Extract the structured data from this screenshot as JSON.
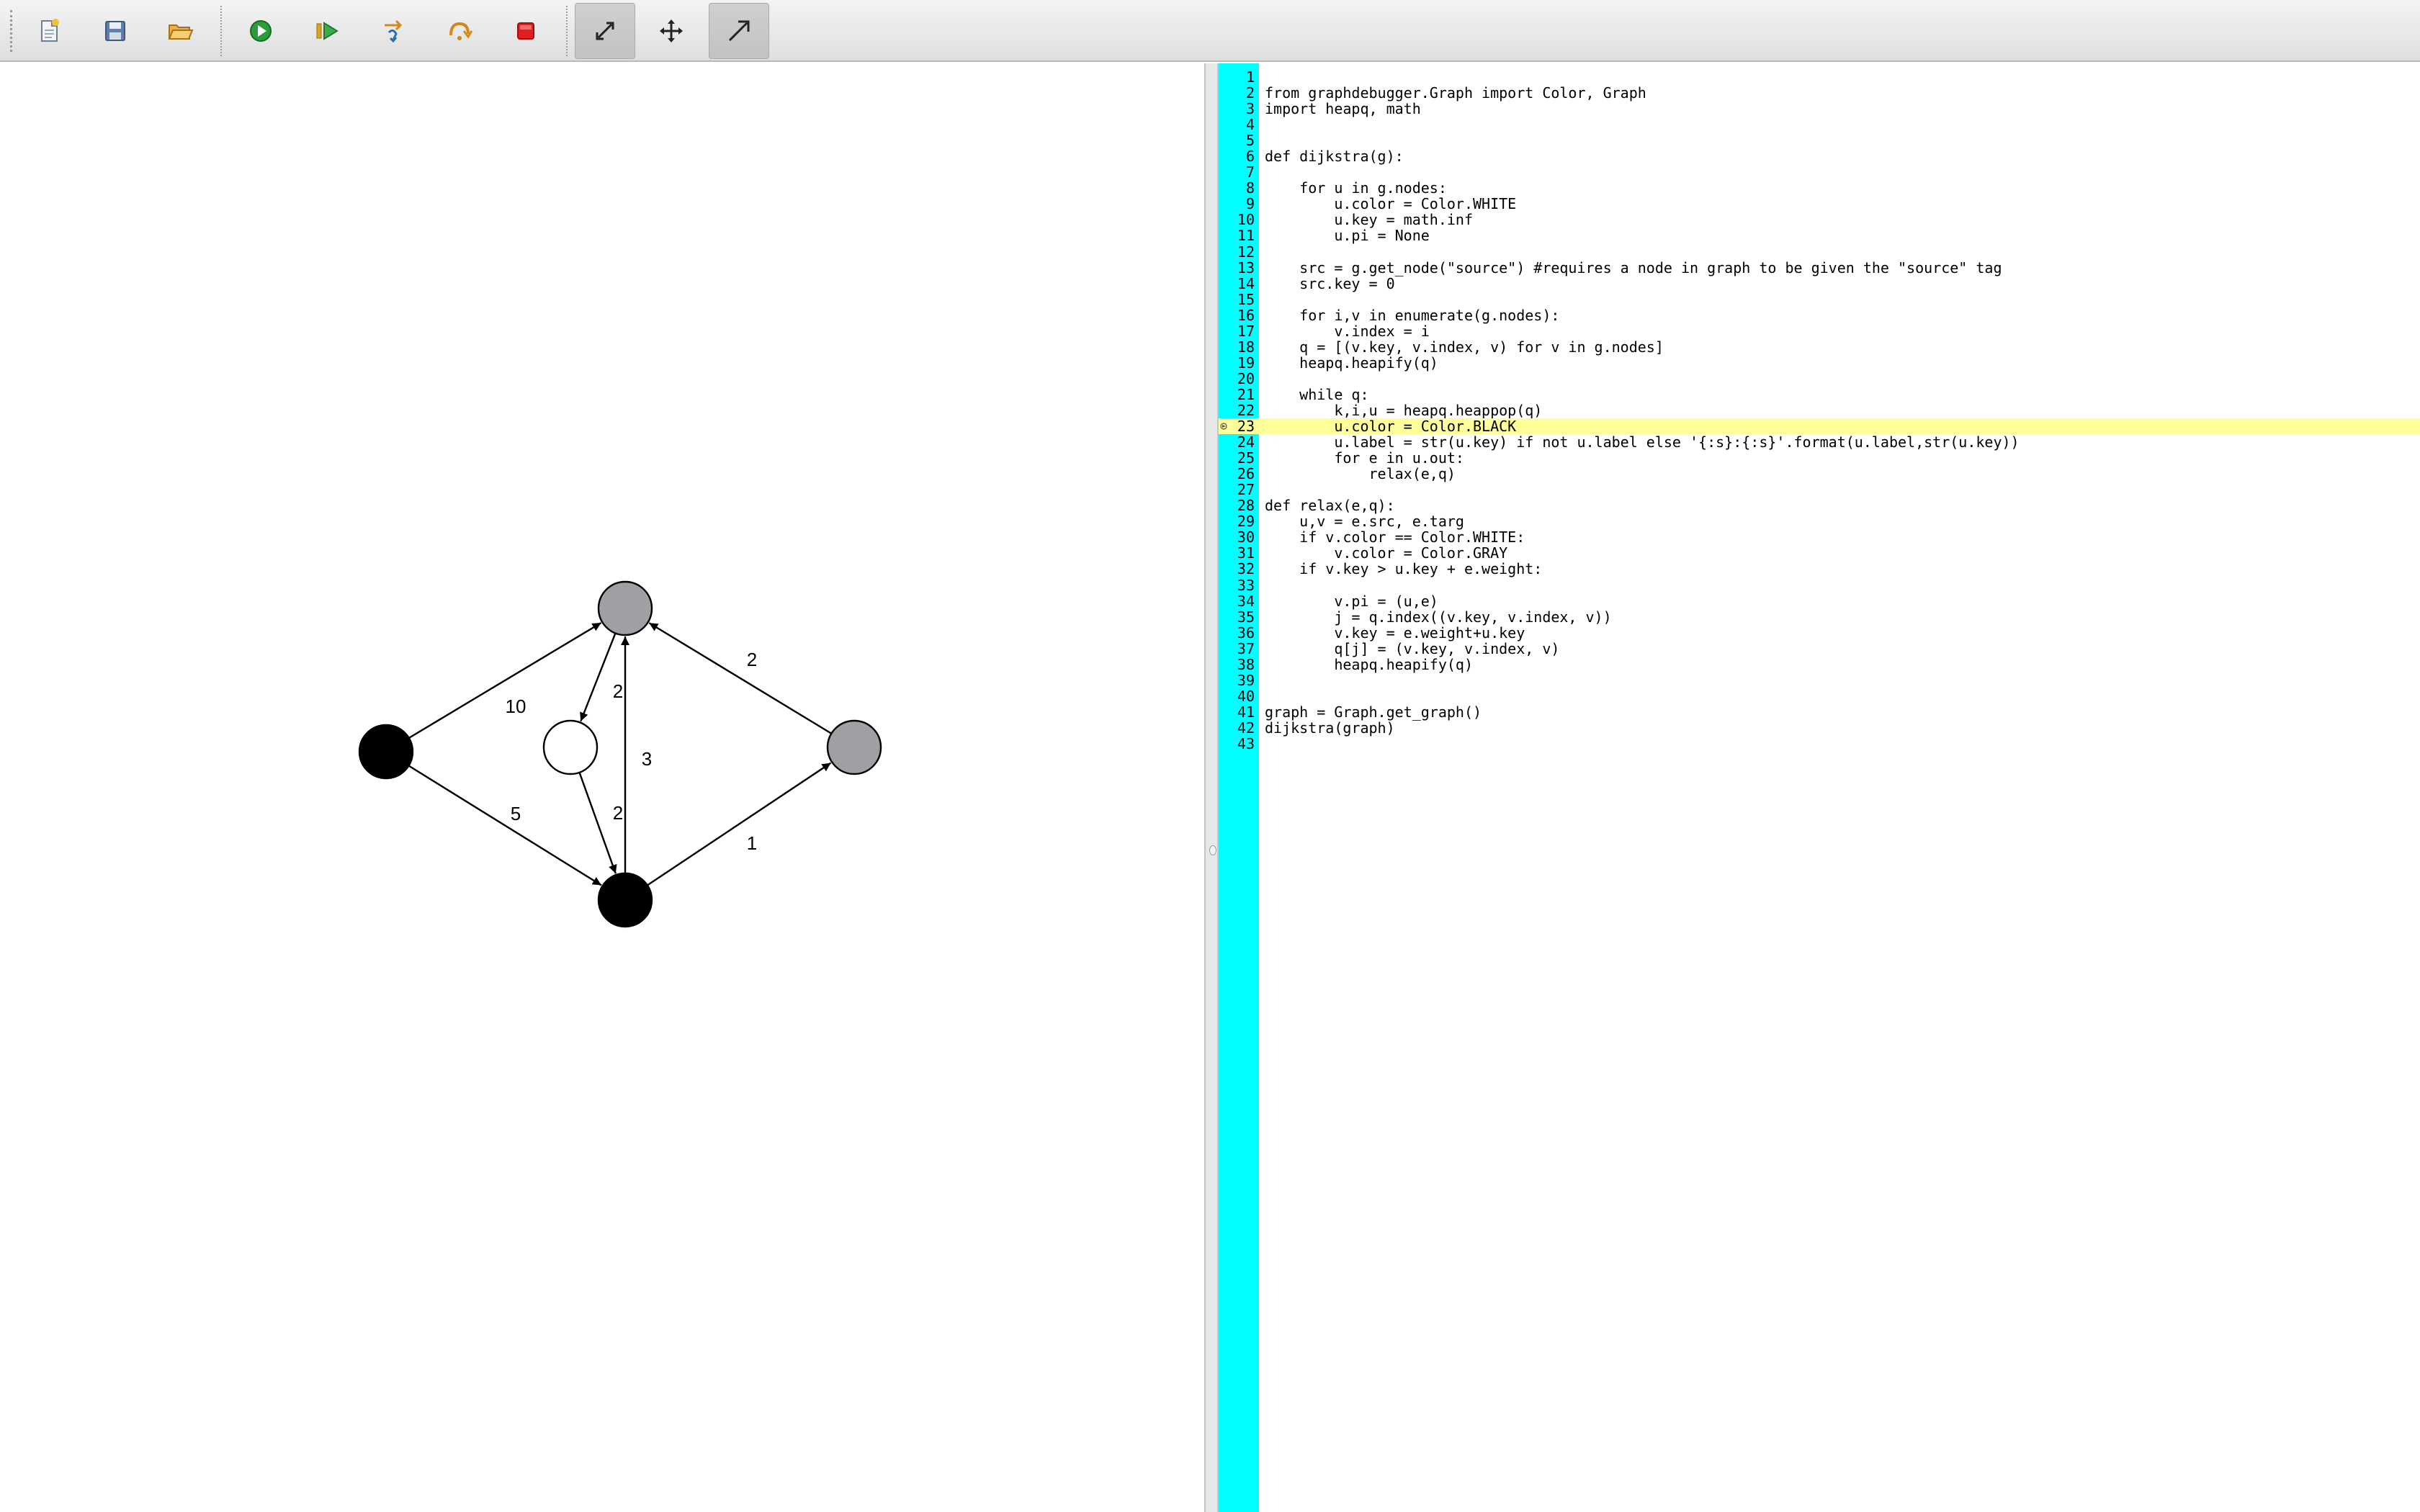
{
  "toolbar": {
    "buttons": [
      {
        "id": "new",
        "icon": "new-file-icon"
      },
      {
        "id": "save",
        "icon": "save-icon"
      },
      {
        "id": "open",
        "icon": "open-folder-icon"
      },
      {
        "id": "run",
        "icon": "run-icon"
      },
      {
        "id": "continue",
        "icon": "continue-icon"
      },
      {
        "id": "step-into",
        "icon": "step-into-icon"
      },
      {
        "id": "step-over",
        "icon": "step-over-icon"
      },
      {
        "id": "stop",
        "icon": "stop-icon"
      },
      {
        "id": "resize-tool",
        "icon": "resize-icon",
        "pressed": true
      },
      {
        "id": "move-tool",
        "icon": "move-icon",
        "pressed": false
      },
      {
        "id": "edge-tool",
        "icon": "edge-arrow-icon",
        "pressed": true
      }
    ],
    "colors": {
      "run": "#2a9d3a",
      "stop": "#e02020",
      "step": "#d08a1a"
    }
  },
  "graph": {
    "nodes": [
      {
        "id": "n-left",
        "fill": "#000000"
      },
      {
        "id": "n-top",
        "fill": "#a0a0a4"
      },
      {
        "id": "n-mid",
        "fill": "#ffffff"
      },
      {
        "id": "n-bottom",
        "fill": "#000000"
      },
      {
        "id": "n-right",
        "fill": "#a0a0a4"
      }
    ],
    "edges": [
      {
        "from": "n-left",
        "to": "n-top",
        "weight": "10"
      },
      {
        "from": "n-left",
        "to": "n-bottom",
        "weight": "5"
      },
      {
        "from": "n-top",
        "to": "n-mid",
        "weight": "2"
      },
      {
        "from": "n-mid",
        "to": "n-bottom",
        "weight": "2"
      },
      {
        "from": "n-bottom",
        "to": "n-top",
        "weight": "3"
      },
      {
        "from": "n-right",
        "to": "n-top",
        "weight": "2"
      },
      {
        "from": "n-bottom",
        "to": "n-right",
        "weight": "1"
      }
    ]
  },
  "editor": {
    "current_line": 23,
    "gutter_color": "#00ffff",
    "highlight_color": "#ffff99",
    "lines": [
      "",
      "from graphdebugger.Graph import Color, Graph",
      "import heapq, math",
      "",
      "",
      "def dijkstra(g):",
      "",
      "    for u in g.nodes:",
      "        u.color = Color.WHITE",
      "        u.key = math.inf",
      "        u.pi = None",
      "",
      "    src = g.get_node(\"source\") #requires a node in graph to be given the \"source\" tag",
      "    src.key = 0",
      "",
      "    for i,v in enumerate(g.nodes):",
      "        v.index = i",
      "    q = [(v.key, v.index, v) for v in g.nodes]",
      "    heapq.heapify(q)",
      "",
      "    while q:",
      "        k,i,u = heapq.heappop(q)",
      "        u.color = Color.BLACK",
      "        u.label = str(u.key) if not u.label else '{:s}:{:s}'.format(u.label,str(u.key))",
      "        for e in u.out:",
      "            relax(e,q)",
      "",
      "def relax(e,q):",
      "    u,v = e.src, e.targ",
      "    if v.color == Color.WHITE:",
      "        v.color = Color.GRAY",
      "    if v.key > u.key + e.weight:",
      "",
      "        v.pi = (u,e)",
      "        j = q.index((v.key, v.index, v))",
      "        v.key = e.weight+u.key",
      "        q[j] = (v.key, v.index, v)",
      "        heapq.heapify(q)",
      "",
      "",
      "graph = Graph.get_graph()",
      "dijkstra(graph)",
      ""
    ]
  }
}
